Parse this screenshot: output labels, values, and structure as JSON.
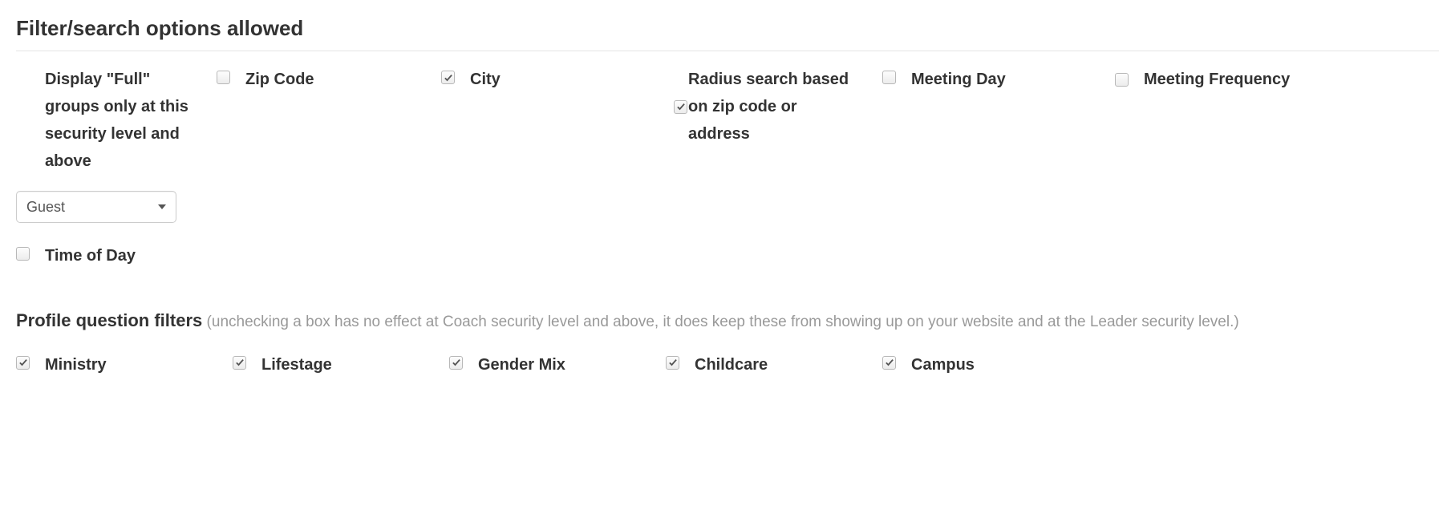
{
  "section_title": "Filter/search options allowed",
  "display_full": {
    "label": "Display \"Full\" groups only at this security level and above",
    "select_value": "Guest"
  },
  "options": {
    "zip_code": {
      "label": "Zip Code",
      "checked": false
    },
    "city": {
      "label": "City",
      "checked": true
    },
    "radius": {
      "label": "Radius search based on zip code or address",
      "checked": true
    },
    "meeting_day": {
      "label": "Meeting Day",
      "checked": false
    },
    "meeting_freq": {
      "label": "Meeting Frequency",
      "checked": false
    },
    "time_of_day": {
      "label": "Time of Day",
      "checked": false
    }
  },
  "profile_filters": {
    "heading": "Profile question filters",
    "help": "(unchecking a box has no effect at Coach security level and above, it does keep these from showing up on your website and at the Leader security level.)",
    "items": {
      "ministry": {
        "label": "Ministry",
        "checked": true
      },
      "lifestage": {
        "label": "Lifestage",
        "checked": true
      },
      "gender_mix": {
        "label": "Gender Mix",
        "checked": true
      },
      "childcare": {
        "label": "Childcare",
        "checked": true
      },
      "campus": {
        "label": "Campus",
        "checked": true
      }
    }
  }
}
